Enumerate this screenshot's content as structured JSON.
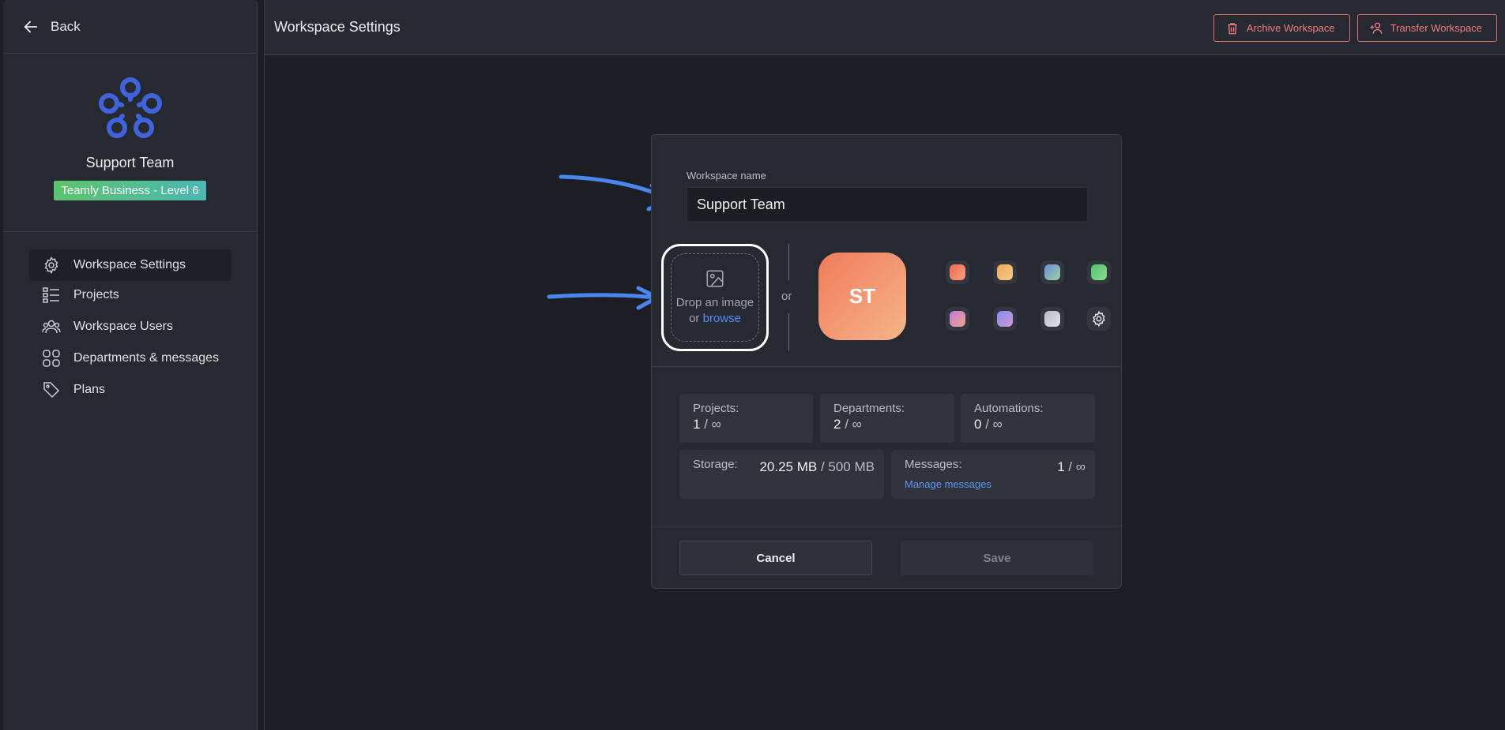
{
  "sidebar": {
    "back_label": "Back",
    "team_name": "Support Team",
    "plan_badge": "Teamly Business - Level 6",
    "nav": [
      {
        "label": "Workspace Settings",
        "icon": "gear-icon",
        "active": true
      },
      {
        "label": "Projects",
        "icon": "list-icon"
      },
      {
        "label": "Workspace Users",
        "icon": "users-icon"
      },
      {
        "label": "Departments & messages",
        "icon": "grid-icon"
      },
      {
        "label": "Plans",
        "icon": "tag-icon"
      }
    ]
  },
  "header": {
    "title": "Workspace Settings",
    "archive_label": "Archive Workspace",
    "transfer_label": "Transfer Workspace"
  },
  "modal": {
    "name_label": "Workspace name",
    "name_value": "Support Team",
    "drop_line1": "Drop an image",
    "drop_or": "or",
    "drop_browse": "browse",
    "or_text": "or",
    "avatar_initials": "ST",
    "swatches": [
      "#f07a5e",
      "#f5b76a",
      "#6fa5c9",
      "#5dc67a",
      "#c88ad6",
      "#8d96f0",
      "#c6cbd6"
    ],
    "stats": {
      "projects_label": "Projects:",
      "projects_value": "1",
      "projects_limit": "/ ∞",
      "departments_label": "Departments:",
      "departments_value": "2",
      "departments_limit": "/ ∞",
      "automations_label": "Automations:",
      "automations_value": "0",
      "automations_limit": "/ ∞",
      "storage_label": "Storage:",
      "storage_value": "20.25 MB",
      "storage_limit": "/ 500 MB",
      "messages_label": "Messages:",
      "messages_value": "1",
      "messages_limit": "/ ∞",
      "manage_messages": "Manage messages"
    },
    "cancel_label": "Cancel",
    "save_label": "Save"
  },
  "colors": {
    "accent_blue": "#4f8ff7",
    "danger": "#e06b6b",
    "logo_blue": "#3e63dd",
    "arrow_blue": "#4a86f0"
  }
}
